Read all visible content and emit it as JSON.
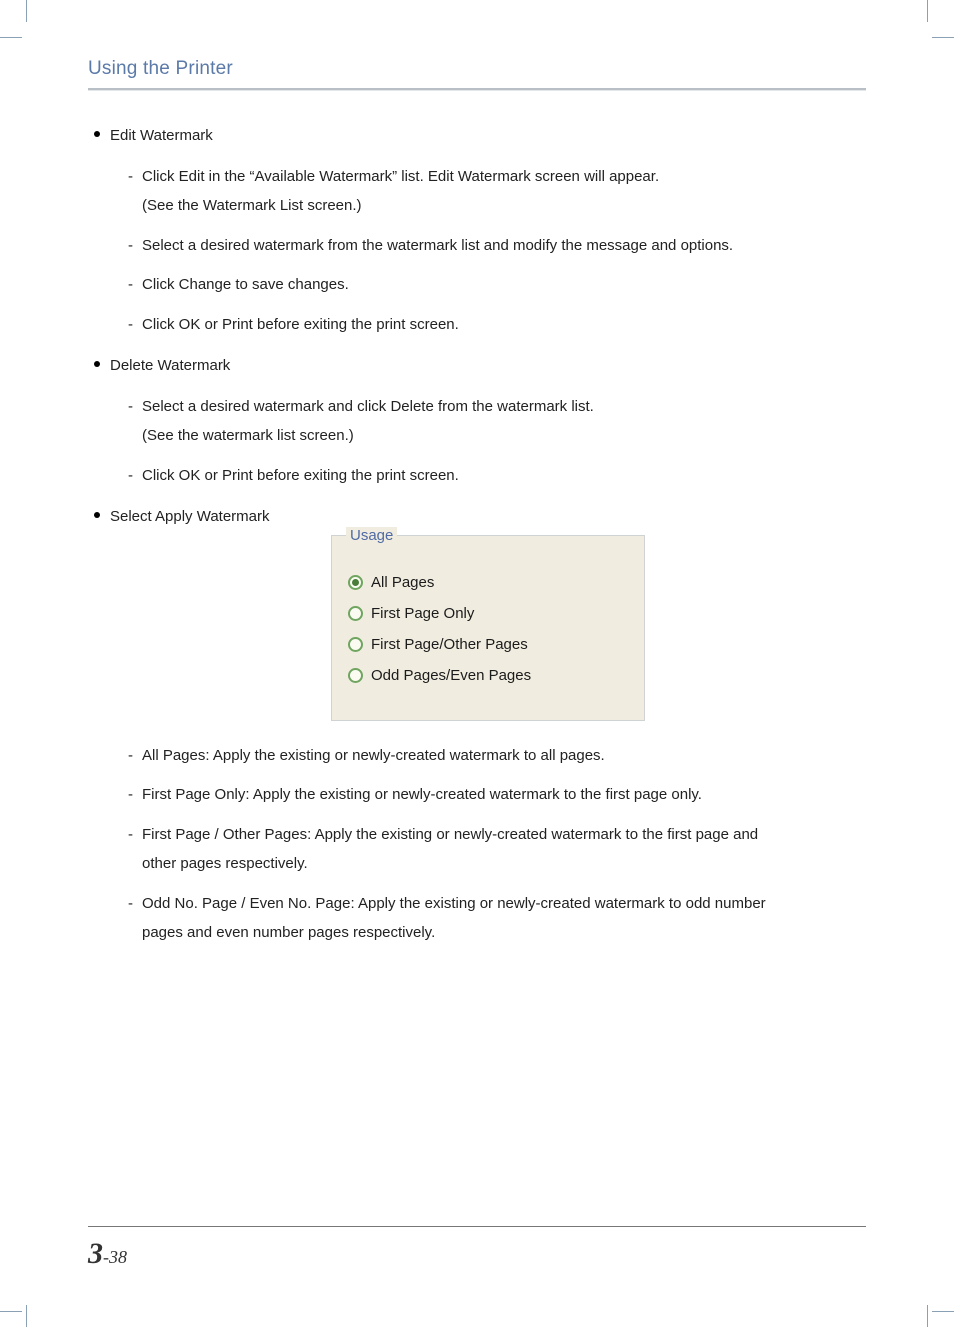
{
  "header": {
    "title": "Using the Printer"
  },
  "sections": {
    "edit": {
      "title": "Edit Watermark",
      "items": [
        {
          "text": "Click Edit in the “Available Watermark” list. Edit Watermark screen will appear.",
          "cont": "(See the Watermark List screen.)"
        },
        {
          "text": "Select a desired watermark from the watermark list and modify the message and options."
        },
        {
          "text": "Click Change to save changes."
        },
        {
          "text": "Click OK or Print before exiting the print screen."
        }
      ]
    },
    "delete": {
      "title": "Delete Watermark",
      "items": [
        {
          "text": "Select a desired watermark and click Delete from the watermark list.",
          "cont": "(See the watermark list screen.)"
        },
        {
          "text": "Click OK or Print before exiting the print screen."
        }
      ]
    },
    "select": {
      "title": "Select Apply Watermark"
    }
  },
  "usage": {
    "legend": "Usage",
    "options": [
      {
        "label": "All Pages",
        "selected": true
      },
      {
        "label": "First Page Only",
        "selected": false
      },
      {
        "label": "First Page/Other Pages",
        "selected": false
      },
      {
        "label": "Odd Pages/Even Pages",
        "selected": false
      }
    ]
  },
  "descriptions": [
    {
      "text": "All Pages: Apply the existing or newly-created watermark to all pages."
    },
    {
      "text": "First Page Only: Apply the existing or newly-created watermark to the first page only."
    },
    {
      "text": "First Page / Other Pages: Apply the existing or newly-created watermark to the first page and",
      "cont": "other pages respectively."
    },
    {
      "text": "Odd No. Page / Even No. Page: Apply the existing or newly-created watermark to odd number",
      "cont": "pages and even number pages respectively."
    }
  ],
  "page_number": {
    "chapter": "3",
    "sep": "-",
    "page": "38"
  }
}
